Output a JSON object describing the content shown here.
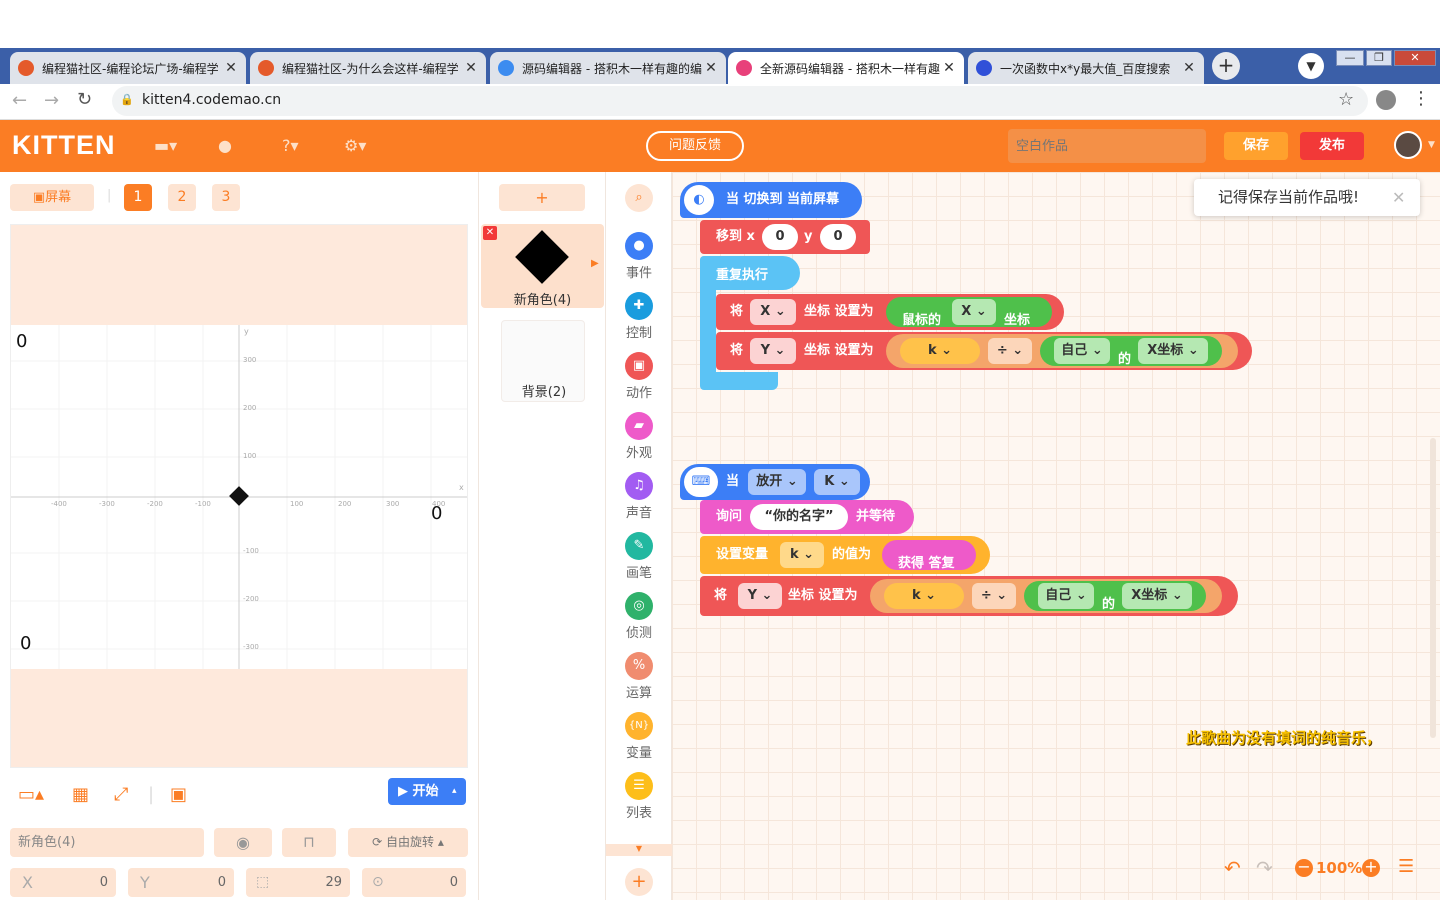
{
  "browser": {
    "tabs": [
      {
        "title": "编程猫社区-编程论坛广场-编程学"
      },
      {
        "title": "编程猫社区-为什么会这样-编程学"
      },
      {
        "title": "源码编辑器 - 搭积木一样有趣的编"
      },
      {
        "title": "全新源码编辑器 - 搭积木一样有趣"
      },
      {
        "title": "一次函数中x*y最大值_百度搜索"
      }
    ],
    "url": "kitten4.codemao.cn"
  },
  "topbar": {
    "logo": "KITTEN",
    "feedback": "问题反馈",
    "work_title_placeholder": "空白作品",
    "save": "保存",
    "publish": "发布"
  },
  "left": {
    "screen_button": "屏幕",
    "screens": [
      "1",
      "2",
      "3"
    ],
    "start": "开始",
    "sprite_name": "新角色(4)",
    "rotation": "自由旋转",
    "x_label": "X",
    "x_value": "0",
    "y_label": "Y",
    "y_value": "0",
    "size_value": "29",
    "direction_value": "0"
  },
  "stage": {
    "markers": [
      "0",
      "0",
      "0"
    ],
    "y_ticks": [
      "300",
      "200",
      "100",
      "-100",
      "-200",
      "-300"
    ],
    "x_ticks": [
      "-400",
      "-300",
      "-200",
      "-100",
      "100",
      "200",
      "300",
      "400"
    ],
    "y_axis_label": "y",
    "x_axis_label": "x"
  },
  "sprites": {
    "add": "+",
    "sprite_label": "新角色(4)",
    "backdrop_label": "背景(2)"
  },
  "categories": [
    {
      "label": "事件",
      "color": "#3c7ef6"
    },
    {
      "label": "控制",
      "color": "#1a9cde"
    },
    {
      "label": "动作",
      "color": "#ef5656"
    },
    {
      "label": "外观",
      "color": "#ee5ac9"
    },
    {
      "label": "声音",
      "color": "#a25cf2"
    },
    {
      "label": "画笔",
      "color": "#22b8a0"
    },
    {
      "label": "侦测",
      "color": "#2fb16b"
    },
    {
      "label": "运算",
      "color": "#f08c6f"
    },
    {
      "label": "变量",
      "color": "#ffb32d"
    },
    {
      "label": "列表",
      "color": "#fdbe1a"
    }
  ],
  "script1": {
    "hat": "当 切换到 当前屏幕",
    "move_label": "移到 x",
    "move_x": "0",
    "move_y_label": "y",
    "move_y": "0",
    "repeat": "重复执行",
    "set1_pre": "将",
    "set1_axis": "X",
    "set1_mid": "坐标 设置为",
    "mouse_pre": "鼠标的",
    "mouse_axis": "X",
    "mouse_post": "坐标",
    "set2_pre": "将",
    "set2_axis": "Y",
    "set2_mid": "坐标 设置为",
    "var_k": "k",
    "div": "÷",
    "self": "自己",
    "of": "的",
    "xcoord": "X坐标"
  },
  "script2": {
    "hat_pre": "当",
    "hat_event": "放开",
    "hat_key": "K",
    "ask_label": "询问",
    "ask_text": "“你的名字”",
    "ask_wait": "并等待",
    "setvar_label": "设置变量",
    "setvar_var": "k",
    "setvar_mid": "的值为",
    "answer": "获得 答复",
    "set_pre": "将",
    "set_axis": "Y",
    "set_mid": "坐标 设置为",
    "var_k": "k",
    "div": "÷",
    "self": "自己",
    "of": "的",
    "xcoord": "X坐标"
  },
  "workspace": {
    "tooltip": "记得保存当前作品哦!",
    "subtitle": "此歌曲为没有填词的纯音乐，",
    "zoom": "100%"
  }
}
